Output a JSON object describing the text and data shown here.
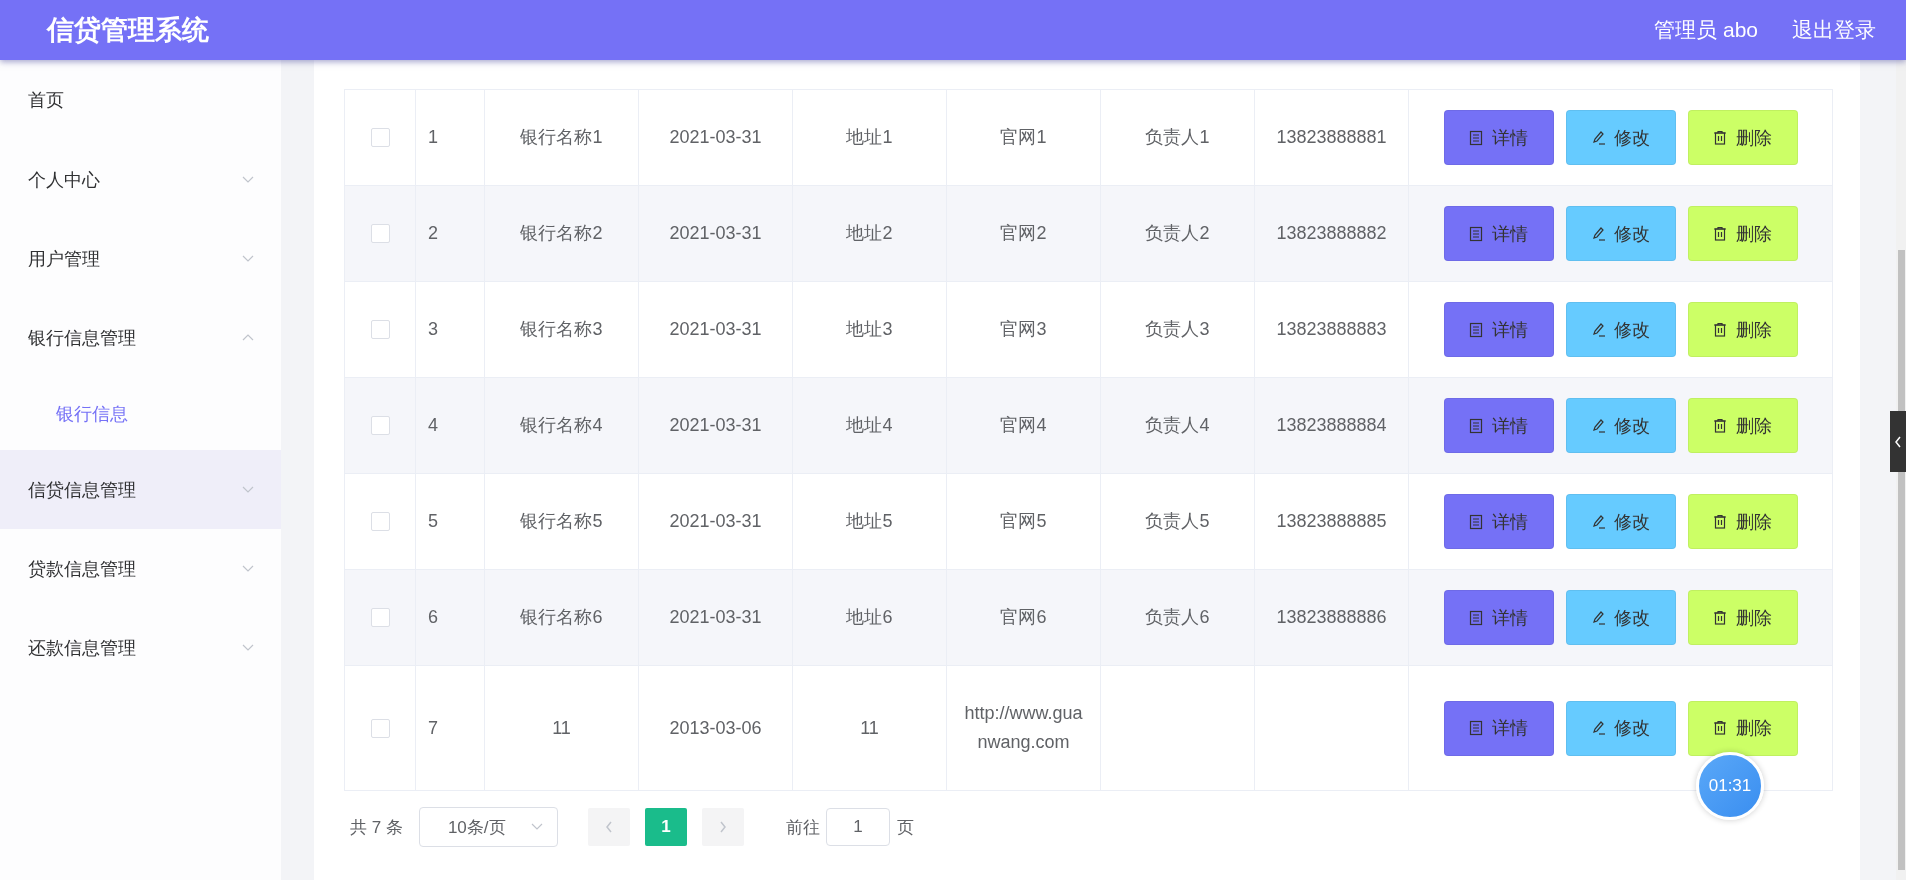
{
  "topbar": {
    "title": "信贷管理系统",
    "user": "管理员 abo",
    "logout": "退出登录"
  },
  "sidebar": {
    "items": [
      {
        "label": "首页",
        "kind": "link",
        "hovered": false
      },
      {
        "label": "个人中心",
        "kind": "group",
        "expanded": false,
        "hovered": false
      },
      {
        "label": "用户管理",
        "kind": "group",
        "expanded": false,
        "hovered": false
      },
      {
        "label": "银行信息管理",
        "kind": "group",
        "expanded": true,
        "hovered": false,
        "children": [
          {
            "label": "银行信息",
            "selected": true
          }
        ]
      },
      {
        "label": "信贷信息管理",
        "kind": "group",
        "expanded": false,
        "hovered": true
      },
      {
        "label": "贷款信息管理",
        "kind": "group",
        "expanded": false,
        "hovered": false
      },
      {
        "label": "还款信息管理",
        "kind": "group",
        "expanded": false,
        "hovered": false
      }
    ]
  },
  "table": {
    "rows": [
      {
        "checked": false,
        "index": "1",
        "bank_name": "银行名称1",
        "founded": "2021-03-31",
        "address": "地址1",
        "website": "官网1",
        "manager": "负责人1",
        "phone": "13823888881",
        "actions": [
          {
            "kind": "detail",
            "label": "详情"
          },
          {
            "kind": "edit",
            "label": "修改"
          },
          {
            "kind": "delete",
            "label": "删除"
          }
        ]
      },
      {
        "checked": false,
        "index": "2",
        "bank_name": "银行名称2",
        "founded": "2021-03-31",
        "address": "地址2",
        "website": "官网2",
        "manager": "负责人2",
        "phone": "13823888882",
        "actions": [
          {
            "kind": "detail",
            "label": "详情"
          },
          {
            "kind": "edit",
            "label": "修改"
          },
          {
            "kind": "delete",
            "label": "删除"
          }
        ]
      },
      {
        "checked": false,
        "index": "3",
        "bank_name": "银行名称3",
        "founded": "2021-03-31",
        "address": "地址3",
        "website": "官网3",
        "manager": "负责人3",
        "phone": "13823888883",
        "actions": [
          {
            "kind": "detail",
            "label": "详情"
          },
          {
            "kind": "edit",
            "label": "修改"
          },
          {
            "kind": "delete",
            "label": "删除"
          }
        ]
      },
      {
        "checked": false,
        "index": "4",
        "bank_name": "银行名称4",
        "founded": "2021-03-31",
        "address": "地址4",
        "website": "官网4",
        "manager": "负责人4",
        "phone": "13823888884",
        "actions": [
          {
            "kind": "detail",
            "label": "详情"
          },
          {
            "kind": "edit",
            "label": "修改"
          },
          {
            "kind": "delete",
            "label": "删除"
          }
        ]
      },
      {
        "checked": false,
        "index": "5",
        "bank_name": "银行名称5",
        "founded": "2021-03-31",
        "address": "地址5",
        "website": "官网5",
        "manager": "负责人5",
        "phone": "13823888885",
        "actions": [
          {
            "kind": "detail",
            "label": "详情"
          },
          {
            "kind": "edit",
            "label": "修改"
          },
          {
            "kind": "delete",
            "label": "删除"
          }
        ]
      },
      {
        "checked": false,
        "index": "6",
        "bank_name": "银行名称6",
        "founded": "2021-03-31",
        "address": "地址6",
        "website": "官网6",
        "manager": "负责人6",
        "phone": "13823888886",
        "actions": [
          {
            "kind": "detail",
            "label": "详情"
          },
          {
            "kind": "edit",
            "label": "修改"
          },
          {
            "kind": "delete",
            "label": "删除"
          }
        ]
      },
      {
        "checked": false,
        "index": "7",
        "bank_name": "11",
        "founded": "2013-03-06",
        "address": "11",
        "website": "http://www.guanwang.com",
        "actions": [
          {
            "kind": "detail",
            "label": "详情"
          },
          {
            "kind": "edit",
            "label": "修改"
          },
          {
            "kind": "delete",
            "label": "删除"
          }
        ]
      }
    ]
  },
  "pagination": {
    "total": "共 7 条",
    "page_size": "10条/页",
    "pages": [
      {
        "label": "1",
        "selected": true
      }
    ],
    "goto_label": "前往",
    "goto_value": "1",
    "goto_suffix": "页"
  },
  "timer": "01:31"
}
